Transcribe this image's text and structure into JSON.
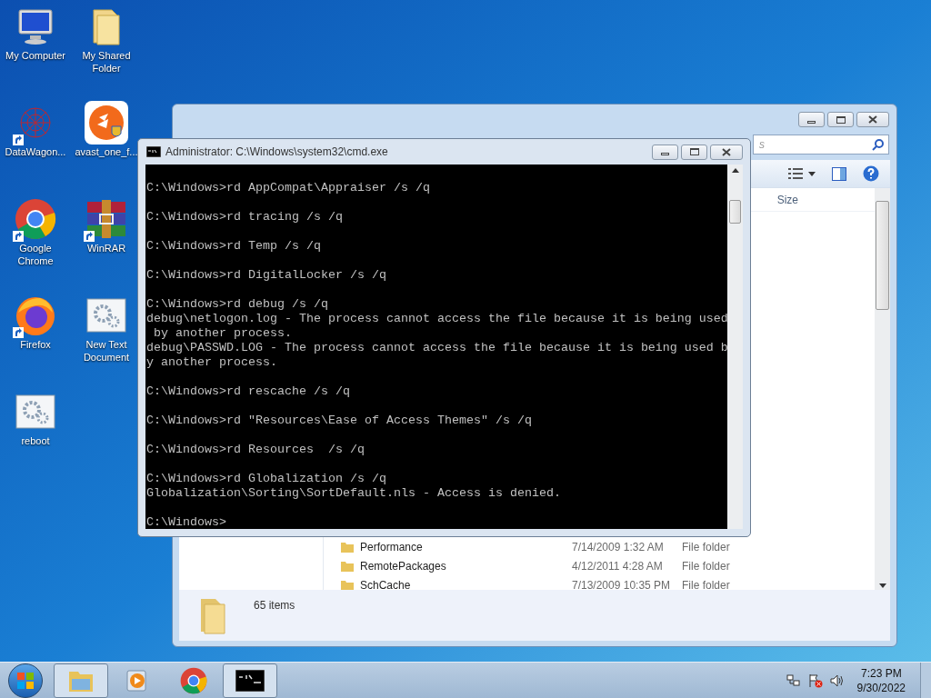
{
  "desktop_icons": [
    {
      "label": "My Computer",
      "kind": "computer",
      "shortcut": false
    },
    {
      "label": "My Shared Folder",
      "kind": "folder",
      "shortcut": false
    },
    {
      "label": "DataWagon...",
      "kind": "network",
      "shortcut": true
    },
    {
      "label": "avast_one_f...",
      "kind": "avast",
      "shortcut": false
    },
    {
      "label": "Google Chrome",
      "kind": "chrome",
      "shortcut": true
    },
    {
      "label": "WinRAR",
      "kind": "winrar",
      "shortcut": true
    },
    {
      "label": "Firefox",
      "kind": "firefox",
      "shortcut": true
    },
    {
      "label": "New Text Document",
      "kind": "script",
      "shortcut": false
    },
    {
      "label": "reboot",
      "kind": "script",
      "shortcut": false
    }
  ],
  "explorer": {
    "search_placeholder": "s",
    "column_header": "Size",
    "rows": [
      {
        "name": "Performance",
        "date": "7/14/2009 1:32 AM",
        "type": "File folder"
      },
      {
        "name": "RemotePackages",
        "date": "4/12/2011 4:28 AM",
        "type": "File folder"
      },
      {
        "name": "SchCache",
        "date": "7/13/2009 10:35 PM",
        "type": "File folder"
      }
    ],
    "status": "65 items"
  },
  "console": {
    "title": "Administrator: C:\\Windows\\system32\\cmd.exe",
    "blocks": [
      [
        "C:\\Windows>rd AppCompat\\Appraiser /s /q"
      ],
      [
        "C:\\Windows>rd tracing /s /q"
      ],
      [
        "C:\\Windows>rd Temp /s /q"
      ],
      [
        "C:\\Windows>rd DigitalLocker /s /q"
      ],
      [
        "C:\\Windows>rd debug /s /q",
        "debug\\netlogon.log - The process cannot access the file because it is being used",
        " by another process.",
        "debug\\PASSWD.LOG - The process cannot access the file because it is being used b",
        "y another process."
      ],
      [
        "C:\\Windows>rd rescache /s /q"
      ],
      [
        "C:\\Windows>rd \"Resources\\Ease of Access Themes\" /s /q"
      ],
      [
        "C:\\Windows>rd Resources  /s /q"
      ],
      [
        "C:\\Windows>rd Globalization /s /q",
        "Globalization\\Sorting\\SortDefault.nls - Access is denied."
      ],
      [
        "C:\\Windows>"
      ]
    ]
  },
  "taskbar": {
    "apps": [
      {
        "kind": "explorer",
        "active": true
      },
      {
        "kind": "media",
        "active": false
      },
      {
        "kind": "chrome",
        "active": false
      },
      {
        "kind": "cmd",
        "active": true
      }
    ],
    "time": "7:23 PM",
    "date": "9/30/2022"
  }
}
